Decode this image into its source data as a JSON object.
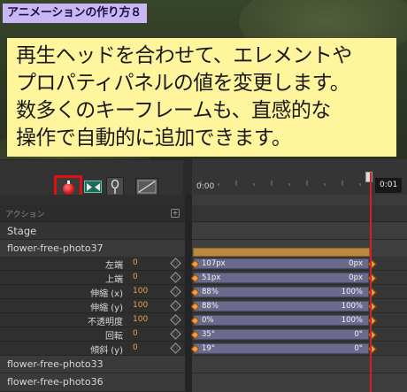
{
  "tutorial": {
    "title": "アニメーションの作り方８",
    "lines": [
      "再生ヘッドを合わせて、エレメントや",
      "プロパティパネルの値を変更します。",
      "数多くのキーフレームも、直感的な",
      "操作で自動的に追加できます。"
    ]
  },
  "toolbar": {
    "record_icon": "record-icon",
    "camera_icon": "camera-icon",
    "pin_icon": "pin-icon",
    "graph_icon": "easing-graph-icon",
    "dropdown_icon": "chevron-down-icon"
  },
  "ruler": {
    "start_time": "0:00",
    "current_time": "0:01"
  },
  "panel": {
    "action_label": "アクション",
    "stage_label": "Stage",
    "symbols": [
      "flower-free-photo37",
      "flower-free-photo33",
      "flower-free-photo36"
    ]
  },
  "properties": [
    {
      "name": "左端",
      "value": "0",
      "from": "107px",
      "to": "0px"
    },
    {
      "name": "上端",
      "value": "0",
      "from": "51px",
      "to": "0px"
    },
    {
      "name": "伸縮 (x)",
      "value": "100",
      "from": "88%",
      "to": "100%"
    },
    {
      "name": "伸縮 (y)",
      "value": "100",
      "from": "88%",
      "to": "100%"
    },
    {
      "name": "不透明度",
      "value": "100",
      "from": "0%",
      "to": "100%"
    },
    {
      "name": "回転",
      "value": "0",
      "from": "35°",
      "to": "0°"
    },
    {
      "name": "傾斜 (y)",
      "value": "0",
      "from": "19°",
      "to": "0°"
    }
  ],
  "colors": {
    "tutorial_box": "#fff59c",
    "title_badge": "#c9b7f3",
    "record_highlight": "#e01010",
    "playhead": "#d42020",
    "keyframe": "#f09c3a",
    "property_value": "#e8a23c",
    "symbol_bar": "#b88a3d",
    "tween_bar": "#6a6b8c"
  }
}
